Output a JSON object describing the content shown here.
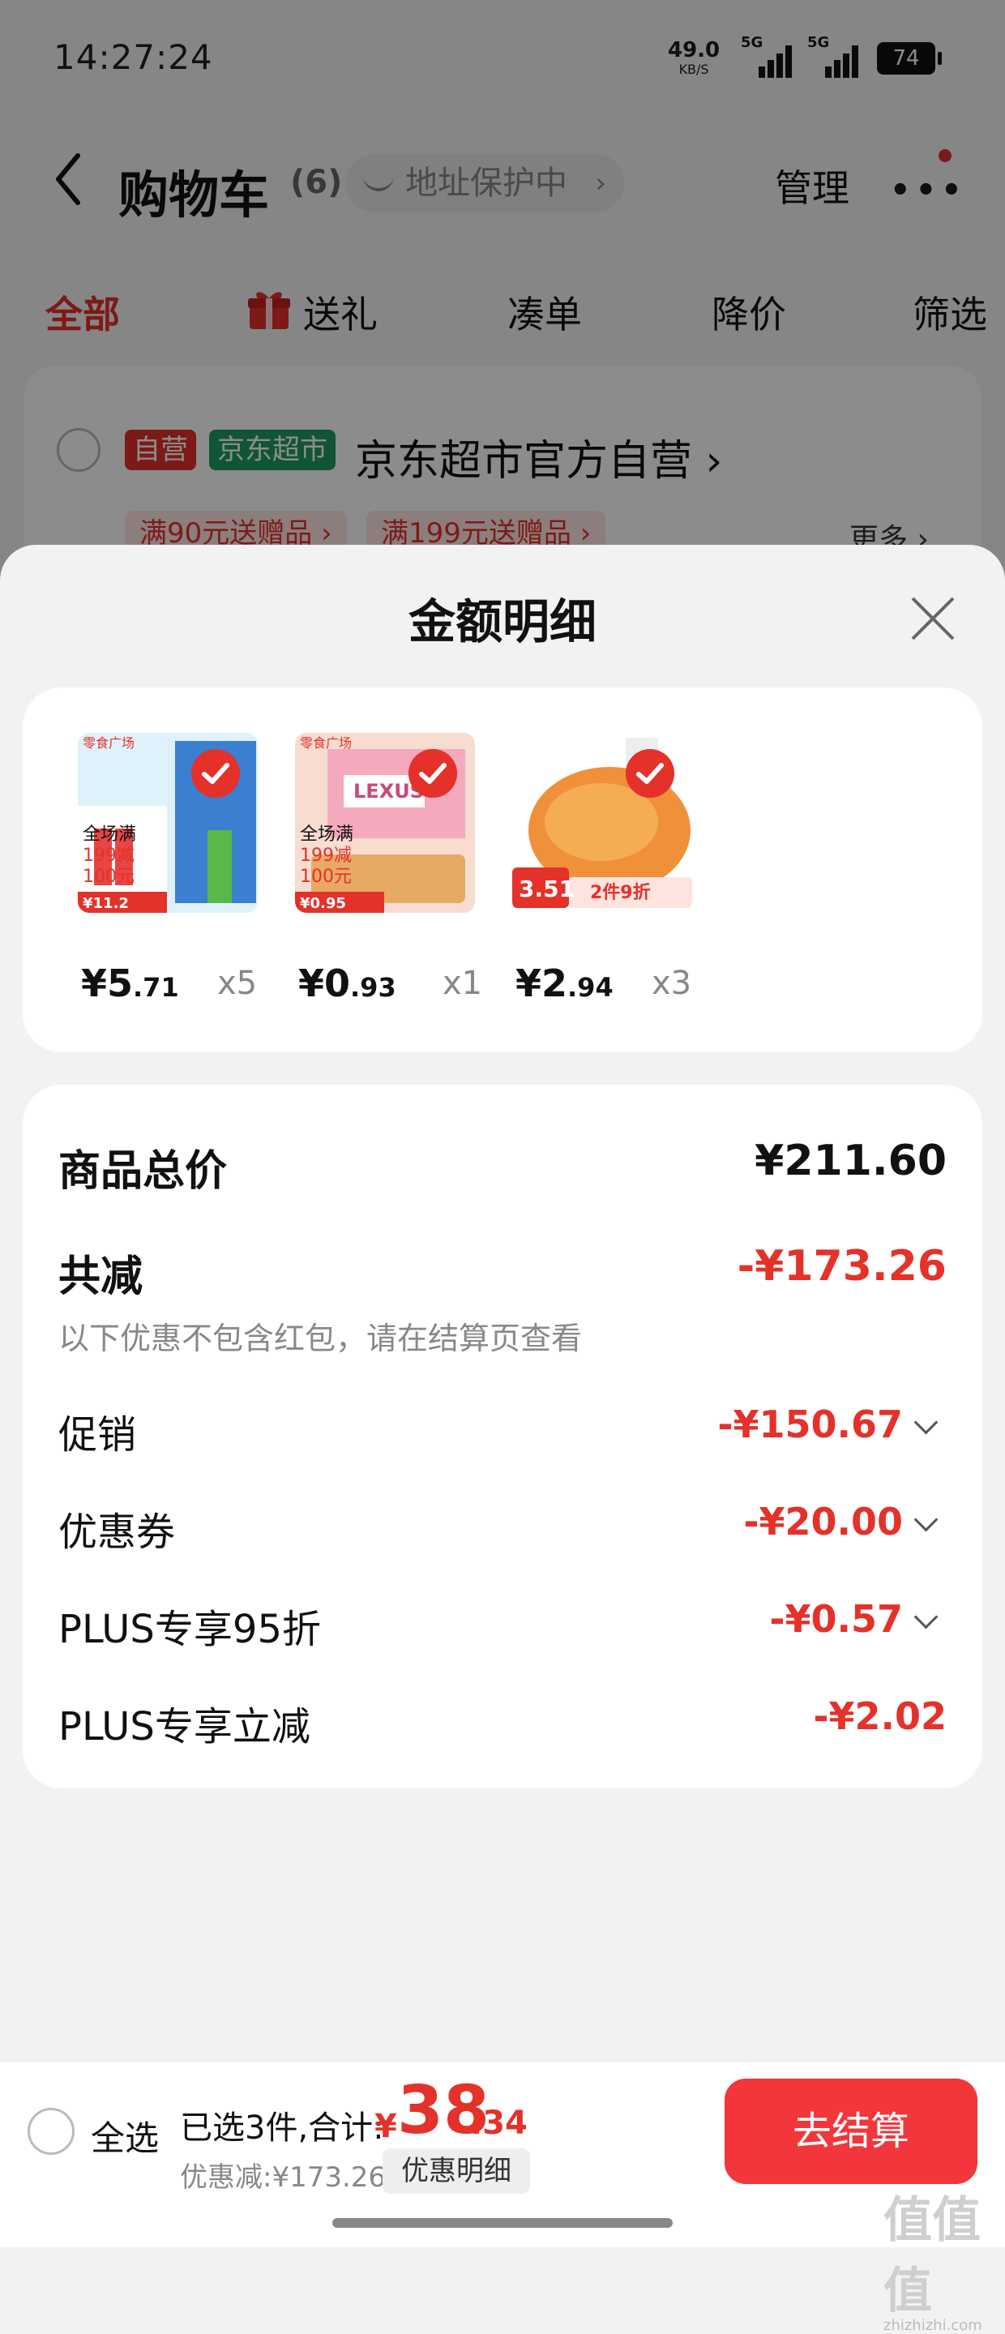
{
  "status_bar": {
    "time": "14:27:24",
    "net_speed": "49.0",
    "net_unit": "KB/S",
    "sig1_label": "5G",
    "sig2_label": "5G",
    "battery": "74"
  },
  "header": {
    "title": "购物车",
    "count": "(6)",
    "address_badge": "地址保护中",
    "manage": "管理"
  },
  "filter_tabs": [
    "全部",
    "送礼",
    "凑单",
    "降价",
    "筛选"
  ],
  "store": {
    "tag_self": "自营",
    "tag_jd": "京东超市",
    "name": "京东超市官方自营 ›",
    "promo1": "满90元送赠品 ›",
    "promo2": "满199元送赠品 ›",
    "more": "更多 ›"
  },
  "sheet": {
    "title": "金额明细",
    "products": [
      {
        "thumb_text_1": "全场满",
        "thumb_text_2": "199减",
        "thumb_text_3": "100元",
        "thumb_price": "¥11.2",
        "price_int": "¥5",
        "price_dec": ".71",
        "qty": "x5"
      },
      {
        "thumb_text_1": "全场满",
        "thumb_text_2": "199减",
        "thumb_text_3": "100元",
        "thumb_price": "¥0.95",
        "price_int": "¥0",
        "price_dec": ".93",
        "qty": "x1"
      },
      {
        "thumb_price": "3.51",
        "thumb_text_1": "2件9折",
        "price_int": "¥2",
        "price_dec": ".94",
        "qty": "x3"
      }
    ],
    "summary": {
      "total_label": "商品总价",
      "total_value": "¥211.60",
      "reduce_label": "共减",
      "reduce_value": "-¥173.26",
      "note": "以下优惠不包含红包，请在结算页查看",
      "rows": [
        {
          "label": "促销",
          "value": "-¥150.67"
        },
        {
          "label": "优惠券",
          "value": "-¥20.00"
        },
        {
          "label": "PLUS专享95折",
          "value": "-¥0.57"
        },
        {
          "label": "PLUS专享立减",
          "value": "-¥2.02"
        }
      ]
    }
  },
  "bottom_bar": {
    "select_all": "全选",
    "selected_text": "已选3件,合计:",
    "currency": "¥",
    "total_int": "38",
    "total_dec": ".34",
    "discount_text": "优惠减:¥173.26",
    "detail_button": "优惠明细",
    "checkout": "去结算"
  },
  "watermark": {
    "main": "值值值",
    "sub": "zhizhizhi.com"
  },
  "colors": {
    "accent": "#e4312a",
    "checkout": "#f3363b",
    "self_tag": "#e4312a",
    "jd_tag": "#1e9c60"
  }
}
